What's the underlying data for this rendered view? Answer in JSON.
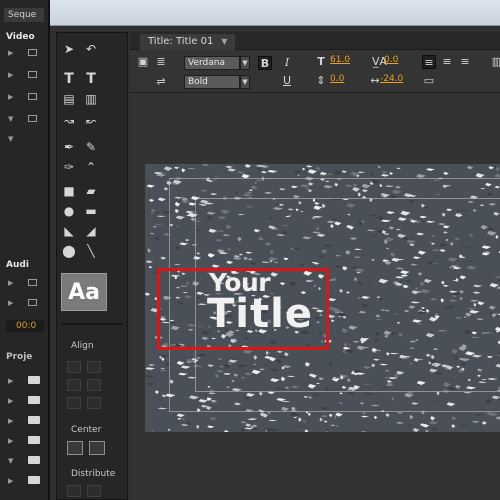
{
  "background_app": {
    "tab_label": "Seque",
    "video_header": "Video",
    "audio_header": "Audi",
    "timecode": "00:0",
    "project_header": "Proje"
  },
  "title_panel": {
    "tab_label": "Title: Title 01",
    "tab_menu_icon": "menu-arrow-icon"
  },
  "toolbar": {
    "font_family": "Verdana",
    "font_style": "Bold",
    "font_size": "61.0",
    "kerning": "0.0",
    "leading": "0.0",
    "tracking": "-24.0"
  },
  "tools_panel": {
    "text_style_sample": "Aa",
    "align_label": "Align",
    "center_label": "Center",
    "distribute_label": "Distribute"
  },
  "canvas": {
    "title_line1": "Your",
    "title_line2": "Title"
  },
  "colors": {
    "highlight_box": "#e11414",
    "value_color": "#e9a21b",
    "panel_bg": "#333333"
  }
}
